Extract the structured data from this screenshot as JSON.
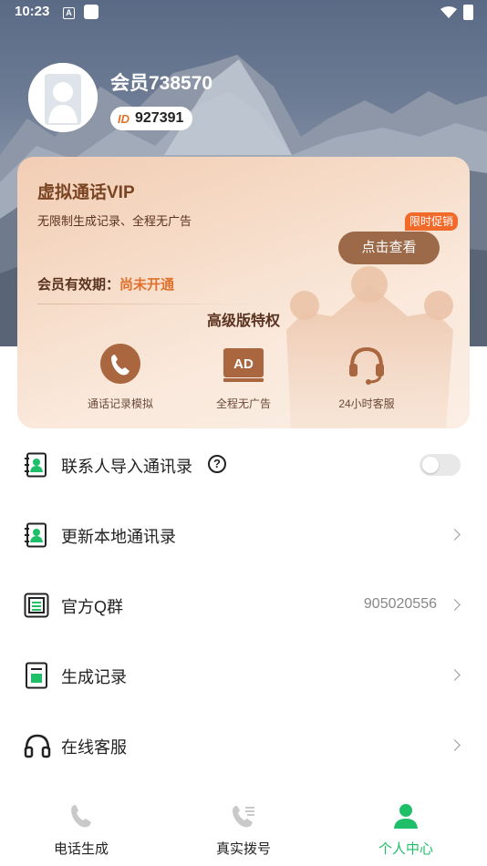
{
  "status_bar": {
    "time": "10:23",
    "a_icon_letter": "A"
  },
  "profile": {
    "username": "会员738570",
    "id_tag": "ID",
    "id_value": "927391"
  },
  "vip_card": {
    "title": "虚拟通话VIP",
    "description": "无限制生成记录、全程无广告",
    "promo_badge": "限时促销",
    "view_button": "点击查看",
    "validity_label": "会员有效期：",
    "validity_value": "尚未开通",
    "perks_title": "高级版特权",
    "perks": [
      {
        "label": "通话记录模拟",
        "icon": "phone-icon"
      },
      {
        "label": "全程无广告",
        "icon": "ad-icon",
        "icon_text": "AD"
      },
      {
        "label": "24小时客服",
        "icon": "headset-icon"
      }
    ]
  },
  "menu": {
    "items": [
      {
        "label": "联系人导入通讯录",
        "icon": "contact-book-icon",
        "help": "?",
        "toggle_on": false
      },
      {
        "label": "更新本地通讯录",
        "icon": "contact-book-icon"
      },
      {
        "label": "官方Q群",
        "icon": "group-icon",
        "value": "905020556"
      },
      {
        "label": "生成记录",
        "icon": "record-icon"
      },
      {
        "label": "在线客服",
        "icon": "headphones-icon"
      }
    ]
  },
  "bottom_nav": {
    "items": [
      {
        "label": "电话生成",
        "icon": "phone-icon",
        "active": false
      },
      {
        "label": "真实拨号",
        "icon": "dialer-icon",
        "active": false
      },
      {
        "label": "个人中心",
        "icon": "person-icon",
        "active": true
      }
    ]
  },
  "colors": {
    "accent_green": "#1fbf6a",
    "accent_orange": "#e0712c",
    "vip_brown": "#9c6a48"
  }
}
